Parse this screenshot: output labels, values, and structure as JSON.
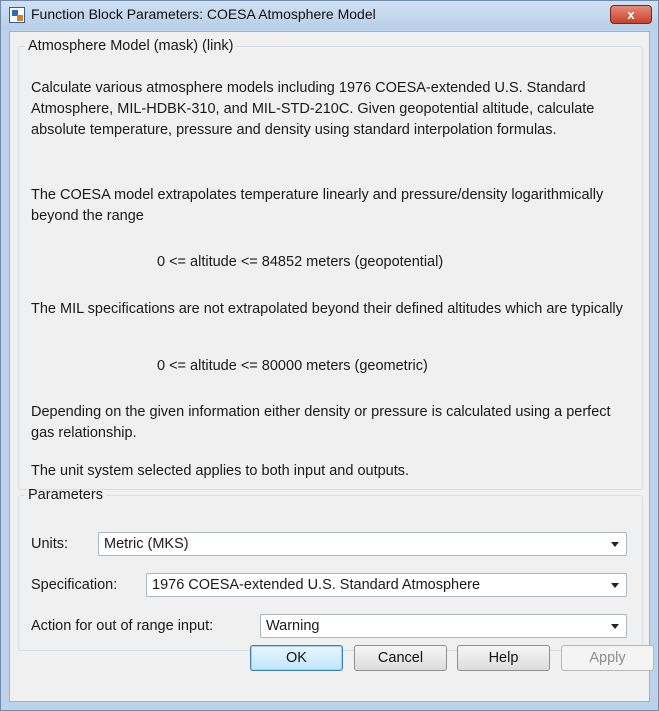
{
  "window": {
    "title": "Function Block Parameters: COESA Atmosphere Model",
    "close_label": "x"
  },
  "description": {
    "legend": "Atmosphere Model (mask) (link)",
    "paragraphs": [
      "Calculate various atmosphere models including 1976 COESA-extended U.S. Standard Atmosphere, MIL-HDBK-310, and MIL-STD-210C.  Given geopotential altitude, calculate absolute temperature, pressure and density using standard interpolation formulas.",
      "The COESA model extrapolates temperature linearly and pressure/density logarithmically beyond the range",
      "0 <= altitude <= 84852 meters (geopotential)",
      "The MIL specifications are not extrapolated beyond their defined altitudes which are typically",
      "0 <= altitude <= 80000 meters (geometric)",
      "Depending on the given information either density or pressure is calculated using a perfect gas relationship.",
      "The unit system selected applies to both input and outputs."
    ]
  },
  "parameters": {
    "legend": "Parameters",
    "units": {
      "label": "Units:",
      "value": "Metric (MKS)"
    },
    "specification": {
      "label": "Specification:",
      "value": "1976 COESA-extended U.S. Standard Atmosphere"
    },
    "action": {
      "label": "Action for out of range input:",
      "value": "Warning"
    }
  },
  "buttons": {
    "ok": "OK",
    "cancel": "Cancel",
    "help": "Help",
    "apply": "Apply"
  }
}
